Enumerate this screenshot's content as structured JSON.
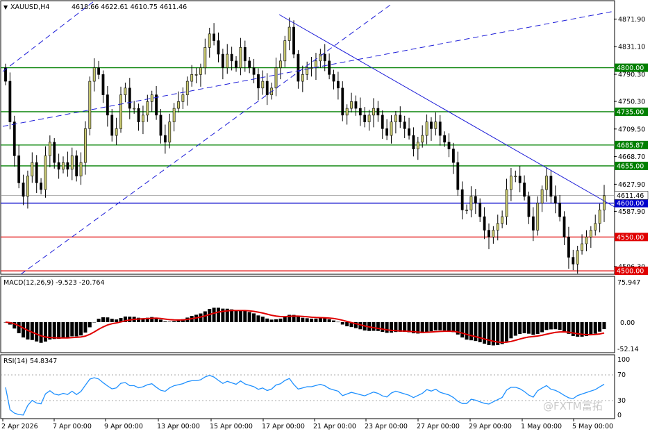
{
  "header": {
    "symbol": "XAUUSD,H4",
    "ohlc": "4618.66 4622.61 4610.75 4611.46"
  },
  "macd": {
    "label": "MACD(12,26,9) -9.523 -20.764",
    "axis": [
      "75.947",
      "0.00",
      "-52.14"
    ]
  },
  "rsi": {
    "label": "RSI(14) 54.8347",
    "axis": [
      "100",
      "70",
      "30",
      "0"
    ]
  },
  "watermark": "@FXTM富拓",
  "colors": {
    "bull": "#c8c870",
    "bear": "#000000",
    "hline_green": "#008000",
    "hline_red": "#e00000",
    "hline_blue": "#0000cc",
    "macd_signal": "#e00000",
    "rsi": "#1e90ff"
  },
  "chart_data": {
    "type": "candlestick",
    "ylim": [
      4496,
      4898
    ],
    "y_tick_labels": [
      "4871.90",
      "4831.10",
      "4790.30",
      "4750.30",
      "4709.50",
      "4668.70",
      "4627.90",
      "4587.90",
      "4506.30"
    ],
    "x_tick_labels": [
      "2 Apr 2026",
      "7 Apr 00:00",
      "9 Apr 00:00",
      "13 Apr 00:00",
      "15 Apr 00:00",
      "17 Apr 00:00",
      "21 Apr 00:00",
      "23 Apr 00:00",
      "27 Apr 00:00",
      "29 Apr 00:00",
      "1 May 00:00",
      "5 May 00:00"
    ],
    "horizontal_levels": [
      {
        "label": "4800.00",
        "value": 4800.0,
        "color": "green"
      },
      {
        "label": "4735.00",
        "value": 4735.0,
        "color": "green"
      },
      {
        "label": "4685.87",
        "value": 4685.87,
        "color": "green"
      },
      {
        "label": "4655.00",
        "value": 4655.0,
        "color": "green"
      },
      {
        "label": "4600.00",
        "value": 4600.0,
        "color": "blue"
      },
      {
        "label": "4550.00",
        "value": 4550.0,
        "color": "red"
      },
      {
        "label": "4500.00",
        "value": 4500.0,
        "color": "red"
      }
    ],
    "current_price": {
      "label": "4611.46",
      "value": 4611.46
    },
    "closes": [
      4780,
      4720,
      4670,
      4630,
      4610,
      4640,
      4660,
      4630,
      4620,
      4670,
      4690,
      4660,
      4650,
      4660,
      4650,
      4670,
      4640,
      4660,
      4710,
      4780,
      4800,
      4790,
      4760,
      4730,
      4700,
      4710,
      4760,
      4770,
      4740,
      4740,
      4720,
      4730,
      4750,
      4760,
      4730,
      4700,
      4690,
      4720,
      4740,
      4750,
      4760,
      4780,
      4790,
      4790,
      4800,
      4830,
      4850,
      4840,
      4820,
      4800,
      4820,
      4810,
      4800,
      4830,
      4810,
      4800,
      4790,
      4770,
      4780,
      4760,
      4770,
      4800,
      4810,
      4840,
      4860,
      4820,
      4780,
      4790,
      4800,
      4800,
      4810,
      4820,
      4810,
      4790,
      4780,
      4770,
      4730,
      4740,
      4750,
      4740,
      4730,
      4720,
      4730,
      4740,
      4730,
      4710,
      4700,
      4720,
      4730,
      4720,
      4710,
      4700,
      4680,
      4690,
      4700,
      4720,
      4710,
      4720,
      4700,
      4690,
      4680,
      4660,
      4620,
      4590,
      4590,
      4610,
      4600,
      4580,
      4560,
      4550,
      4560,
      4570,
      4580,
      4620,
      4640,
      4640,
      4630,
      4610,
      4580,
      4560,
      4600,
      4620,
      4640,
      4610,
      4600,
      4580,
      4550,
      4520,
      4510,
      4530,
      4540,
      4550,
      4560,
      4570,
      4590,
      4611
    ]
  }
}
